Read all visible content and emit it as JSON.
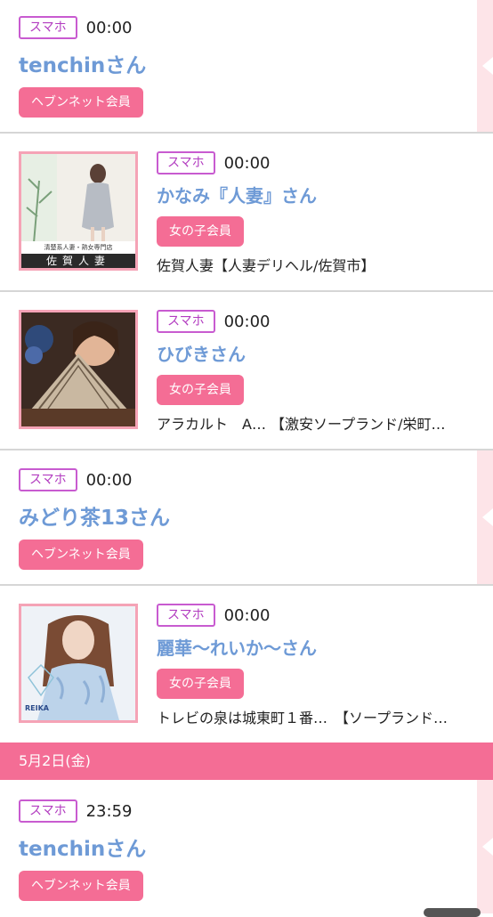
{
  "colors": {
    "member_badge": "#f46d95",
    "device_badge_border": "#c85bd0",
    "name": "#6e9ad6",
    "date_bar": "#f46d95",
    "side_strip": "#fde4e8"
  },
  "entries_top": [
    {
      "device": "スマホ",
      "time": "00:00",
      "name": "tenchinさん",
      "member_type": "ヘブンネット会員"
    },
    {
      "device": "スマホ",
      "time": "00:00",
      "name": "かなみ『人妻』さん",
      "member_type": "女の子会員",
      "shop": "佐賀人妻【人妻デリヘル/佐賀市】",
      "thumb_caption": "清楚系人妻・熟女専門店",
      "thumb_logo": "佐賀人妻"
    },
    {
      "device": "スマホ",
      "time": "00:00",
      "name": "ひびきさん",
      "member_type": "女の子会員",
      "shop": "アラカルト　A… 【激安ソープランド/栄町…"
    },
    {
      "device": "スマホ",
      "time": "00:00",
      "name": "みどり茶13さん",
      "member_type": "ヘブンネット会員"
    },
    {
      "device": "スマホ",
      "time": "00:00",
      "name": "麗華〜れいか〜さん",
      "member_type": "女の子会員",
      "shop": "トレビの泉は城東町１番…　【ソープランド…",
      "thumb_logo": "REIKA"
    }
  ],
  "date_header": "5月2日(金)",
  "entries_bottom": [
    {
      "device": "スマホ",
      "time": "23:59",
      "name": "tenchinさん",
      "member_type": "ヘブンネット会員"
    }
  ]
}
